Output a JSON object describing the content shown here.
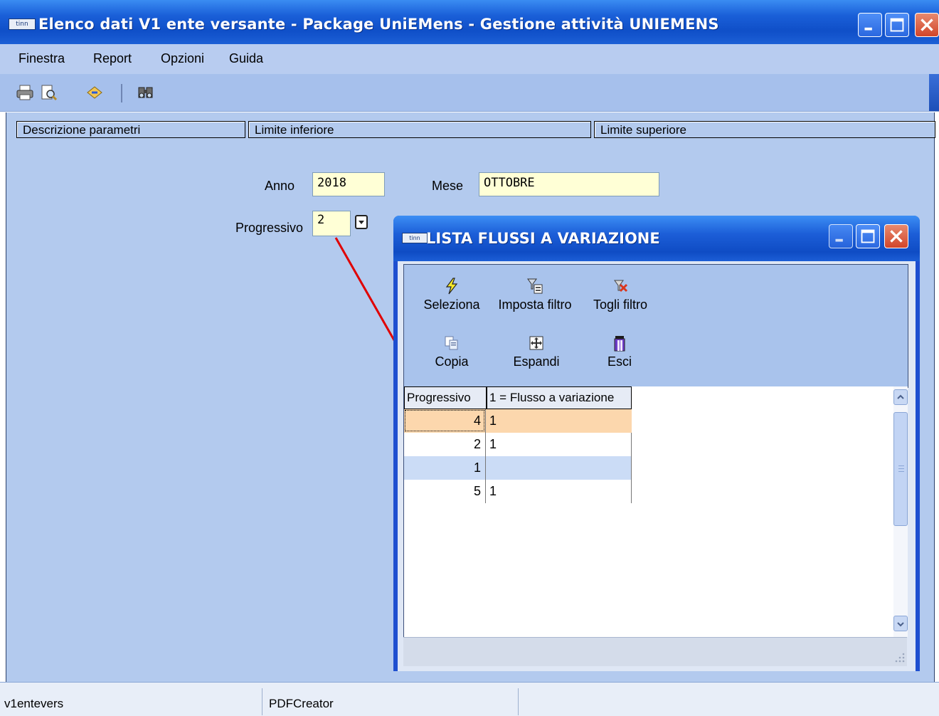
{
  "window": {
    "icon_text": "tinn",
    "title": "Elenco dati V1 ente versante - Package UniEMens - Gestione attività UNIEMENS"
  },
  "menu": {
    "items": [
      "Finestra",
      "Report",
      "Opzioni",
      "Guida"
    ]
  },
  "toolbar": {
    "icons": [
      "print-icon",
      "print-preview-icon",
      "export-icon",
      "find-icon"
    ]
  },
  "params": {
    "headers": [
      "Descrizione parametri",
      "Limite inferiore",
      "Limite superiore"
    ],
    "anno_label": "Anno",
    "anno_value": "2018",
    "mese_label": "Mese",
    "mese_value": "OTTOBRE",
    "progressivo_label": "Progressivo",
    "progressivo_value": "2"
  },
  "dialog": {
    "icon_text": "tinn",
    "title": "LISTA FLUSSI A VARIAZIONE",
    "buttons": {
      "seleziona": "Seleziona",
      "imposta_filtro": "Imposta filtro",
      "togli_filtro": "Togli filtro",
      "copia": "Copia",
      "espandi": "Espandi",
      "esci": "Esci"
    },
    "grid": {
      "columns": [
        "Progressivo",
        "1 = Flusso a variazione"
      ],
      "rows": [
        {
          "progressivo": "4",
          "flusso": "1"
        },
        {
          "progressivo": "2",
          "flusso": "1"
        },
        {
          "progressivo": "1",
          "flusso": ""
        },
        {
          "progressivo": "5",
          "flusso": "1"
        }
      ]
    }
  },
  "status": {
    "cells": [
      "v1entevers",
      "PDFCreator"
    ]
  },
  "colors": {
    "titlebar": "#1a5fd8",
    "selected_row": "#fcd7ad",
    "alt_row": "#cbdcf6",
    "field_bg": "#ffffd6",
    "arrow": "#e00000"
  }
}
